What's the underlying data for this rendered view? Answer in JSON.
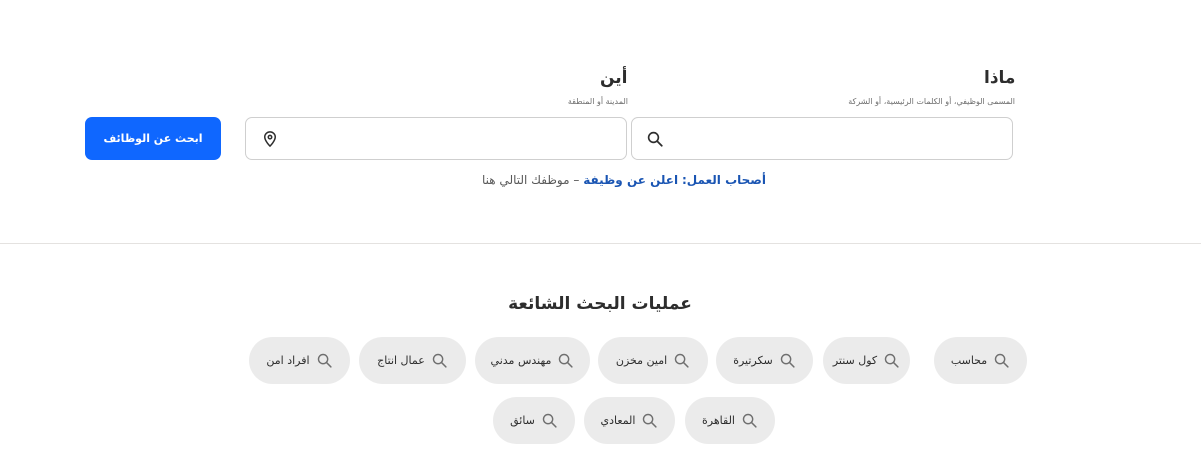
{
  "search": {
    "what": {
      "label": "ماذا",
      "hint": "المسمى الوظيفي، أو الكلمات الرئيسية، أو الشركة",
      "value": "",
      "placeholder": "",
      "icon": "search-icon"
    },
    "where": {
      "label": "أين",
      "hint": "المدينة أو المنطقة",
      "value": "",
      "placeholder": "",
      "icon": "map-pin-icon"
    },
    "button_label": "ابحث عن الوظائف"
  },
  "employers": {
    "prefix": "أصحاب العمل:",
    "link": "اعلن عن وظيفة",
    "suffix": "– موظفك التالي هنا"
  },
  "popular": {
    "title": "عمليات البحث الشائعة",
    "items": [
      "محاسب",
      "كول سنتر",
      "سكرتيرة",
      "امين مخزن",
      "مهندس مدني",
      "عمال انتاج",
      "افراد امن",
      "القاهرة",
      "المعادي",
      "سائق"
    ]
  },
  "colors": {
    "primary_button": "#0f67ff",
    "link": "#1a55b3",
    "pill_background": "#ebebeb"
  }
}
